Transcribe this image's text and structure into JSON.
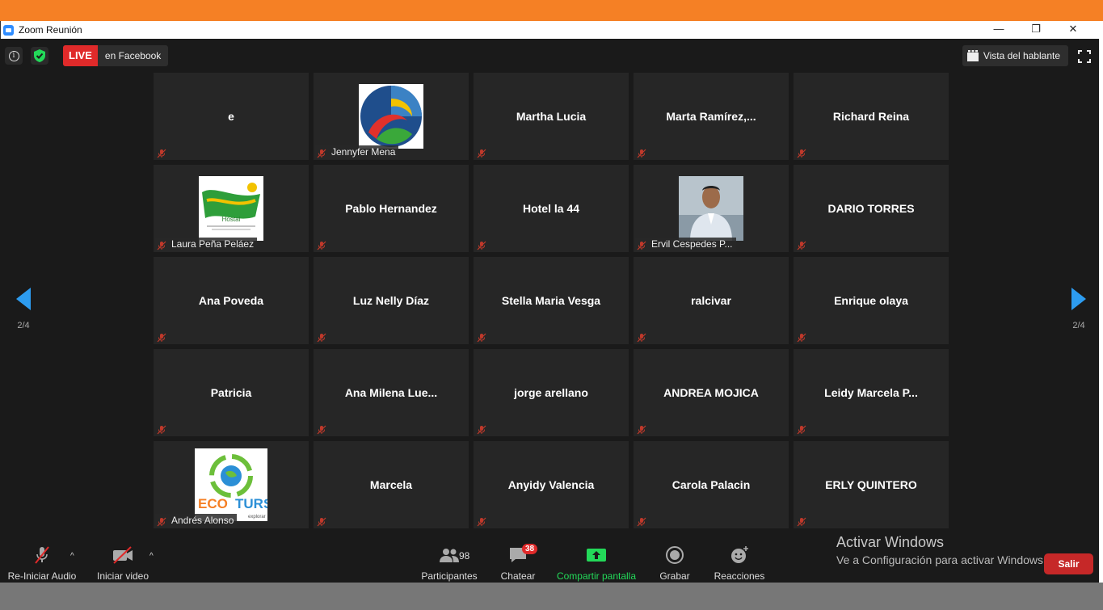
{
  "window": {
    "title": "Zoom Reunión",
    "controls": [
      "—",
      "❐",
      "✕"
    ]
  },
  "topbar": {
    "live_label": "LIVE",
    "live_destination": "en Facebook",
    "speaker_view_label": "Vista del hablante"
  },
  "navigation": {
    "prev_page": "2/4",
    "next_page": "2/4"
  },
  "participants": [
    {
      "name": "e",
      "style": "center"
    },
    {
      "name": "Jennyfer Mena",
      "style": "thumb",
      "thumb": "logo-circle"
    },
    {
      "name": "Martha Lucia",
      "style": "center"
    },
    {
      "name": "Marta  Ramírez,...",
      "style": "center"
    },
    {
      "name": "Richard Reina",
      "style": "center"
    },
    {
      "name": "Laura Peña Peláez",
      "style": "thumb",
      "thumb": "hostal-logo"
    },
    {
      "name": "Pablo Hernandez",
      "style": "center"
    },
    {
      "name": "Hotel la 44",
      "style": "center"
    },
    {
      "name": "Ervil Cespedes P...",
      "style": "thumb",
      "thumb": "photo"
    },
    {
      "name": "DARIO TORRES",
      "style": "center"
    },
    {
      "name": "Ana Poveda",
      "style": "center"
    },
    {
      "name": "Luz Nelly Díaz",
      "style": "center"
    },
    {
      "name": "Stella Maria Vesga",
      "style": "center"
    },
    {
      "name": "ralcivar",
      "style": "center"
    },
    {
      "name": "Enrique olaya",
      "style": "center"
    },
    {
      "name": "Patricia",
      "style": "center"
    },
    {
      "name": "Ana  Milena  Lue...",
      "style": "center"
    },
    {
      "name": "jorge arellano",
      "style": "center"
    },
    {
      "name": "ANDREA MOJICA",
      "style": "center"
    },
    {
      "name": "Leidy  Marcela  P...",
      "style": "center"
    },
    {
      "name": "Andrés Alonso",
      "style": "thumb",
      "thumb": "ecoturs-logo"
    },
    {
      "name": "Marcela",
      "style": "center"
    },
    {
      "name": "Anyidy Valencia",
      "style": "center"
    },
    {
      "name": "Carola Palacin",
      "style": "center"
    },
    {
      "name": "ERLY QUINTERO",
      "style": "center"
    }
  ],
  "hostal_logo_text": "Hostal",
  "ecoturs_logo": {
    "left": "ECO",
    "right": "TURS",
    "tag": "explorar"
  },
  "toolbar": {
    "audio_label": "Re-Iniciar Audio",
    "video_label": "Iniciar video",
    "participants_label": "Participantes",
    "participants_count": "98",
    "chat_label": "Chatear",
    "chat_badge": "38",
    "share_label": "Compartir pantalla",
    "record_label": "Grabar",
    "reactions_label": "Reacciones",
    "leave_label": "Salir"
  },
  "watermark": {
    "line1": "Activar Windows",
    "line2": "Ve a Configuración para activar Windows."
  },
  "colors": {
    "accent_orange": "#f58025",
    "live_red": "#e02a2a",
    "share_green": "#23d959",
    "nav_blue": "#2d9cf0",
    "leave_red": "#c62828"
  }
}
